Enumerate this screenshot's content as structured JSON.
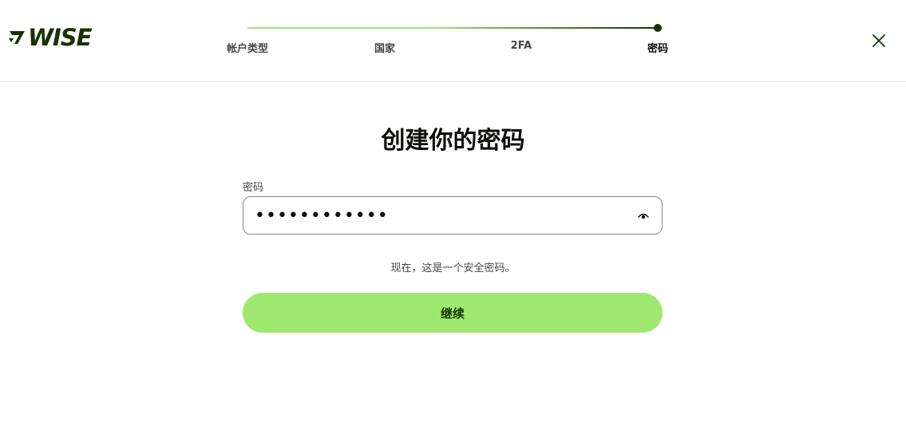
{
  "brand": {
    "name": "WISE",
    "color": "#163300",
    "accent": "#9fe870"
  },
  "stepper": {
    "steps": [
      {
        "label": "帐户类型",
        "state": "done"
      },
      {
        "label": "国家",
        "state": "done"
      },
      {
        "label": "2FA",
        "state": "done"
      },
      {
        "label": "密码",
        "state": "current"
      }
    ],
    "progress": 1.0
  },
  "header": {
    "close_icon": "close-icon"
  },
  "main": {
    "title": "创建你的密码",
    "password_field": {
      "label": "密码",
      "value": "••••••••••••",
      "toggle_icon": "eye-icon"
    },
    "hint": "现在，这是一个安全密码。",
    "continue_label": "继续"
  }
}
